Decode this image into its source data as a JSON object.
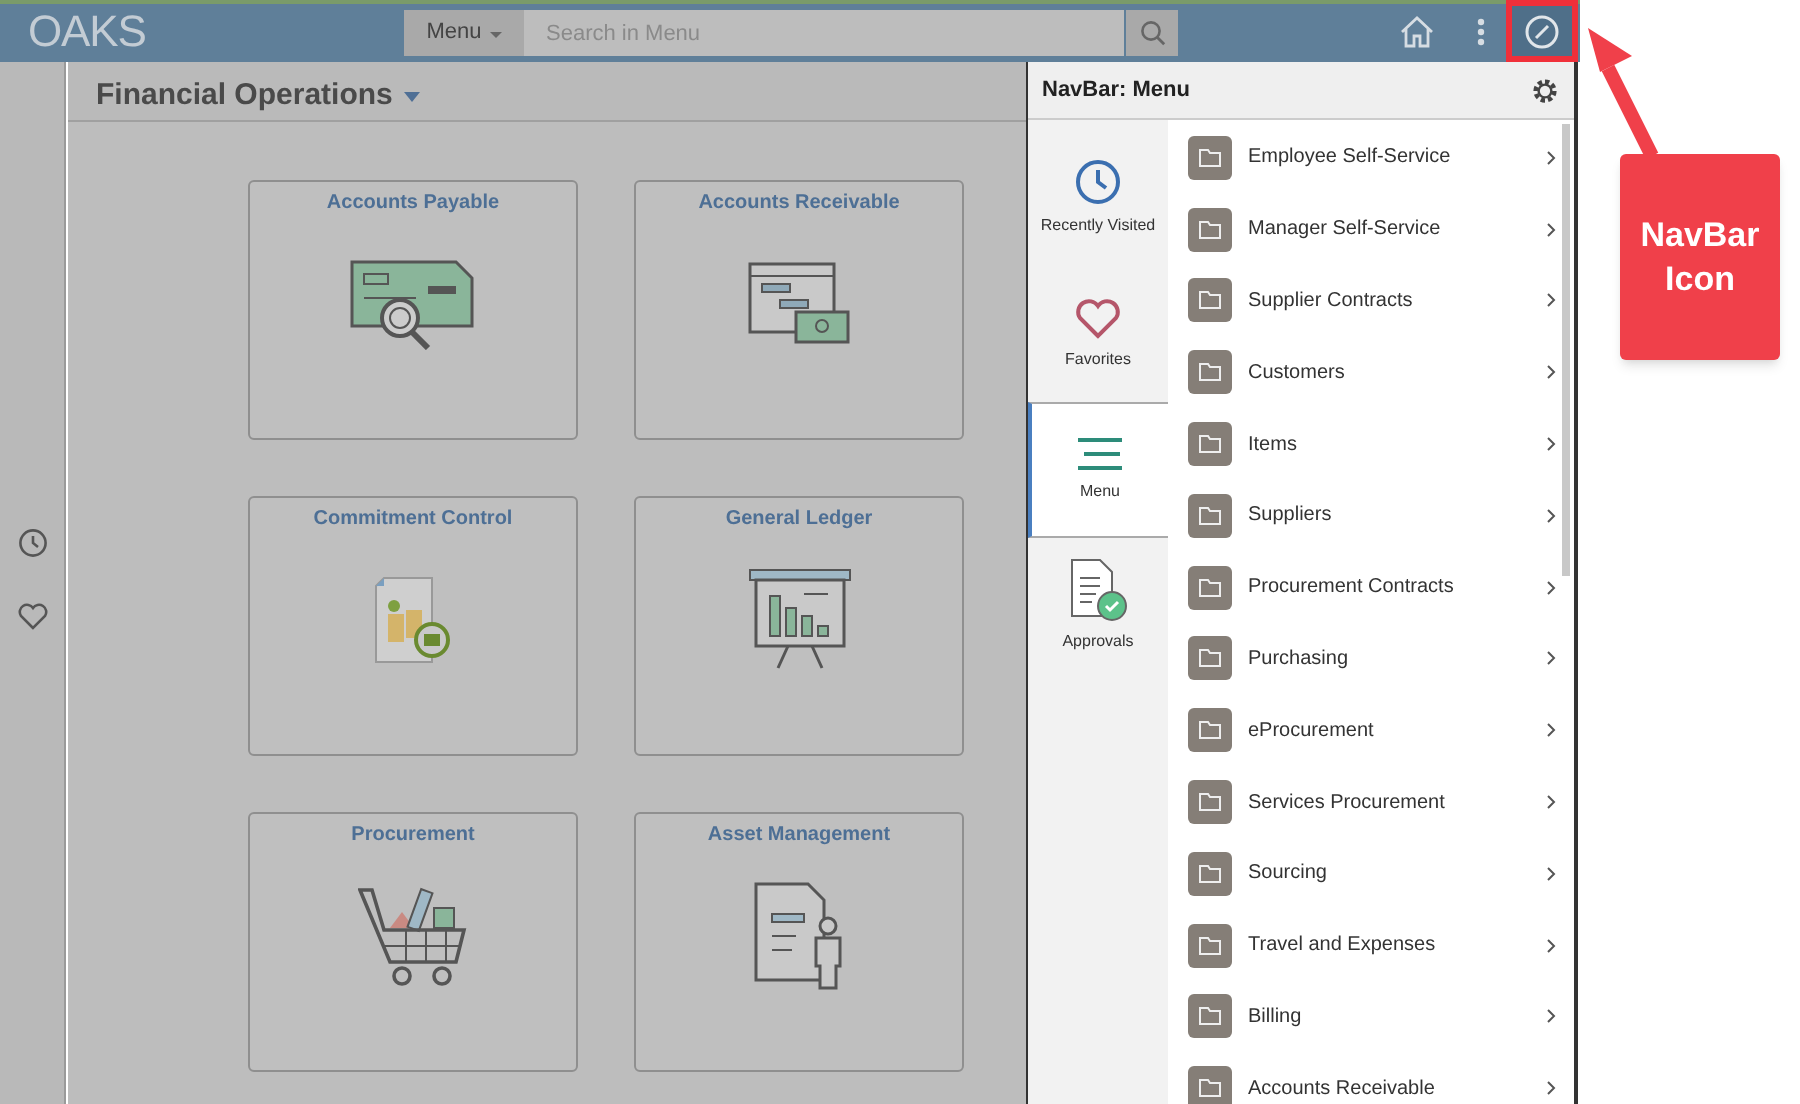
{
  "header": {
    "logo": "OAKS",
    "menu_button": "Menu",
    "search": {
      "placeholder": "Search in Menu"
    }
  },
  "page": {
    "title": "Financial Operations",
    "tiles": [
      {
        "label": "Accounts Payable",
        "kind": "check"
      },
      {
        "label": "Accounts Receivable",
        "kind": "invoice"
      },
      {
        "label": "Commitment Control",
        "kind": "approval"
      },
      {
        "label": "General Ledger",
        "kind": "chart"
      },
      {
        "label": "Procurement",
        "kind": "cart"
      },
      {
        "label": "Asset Management",
        "kind": "document"
      }
    ]
  },
  "navbar": {
    "title": "NavBar: Menu",
    "tabs": [
      {
        "label": "Recently Visited",
        "kind": "clock",
        "selected": false
      },
      {
        "label": "Favorites",
        "kind": "heart",
        "selected": false
      },
      {
        "label": "Menu",
        "kind": "menu",
        "selected": true
      },
      {
        "label": "Approvals",
        "kind": "approvals",
        "selected": false
      }
    ],
    "items": [
      {
        "label": "Employee Self-Service"
      },
      {
        "label": "Manager Self-Service"
      },
      {
        "label": "Supplier Contracts"
      },
      {
        "label": "Customers"
      },
      {
        "label": "Items"
      },
      {
        "label": "Suppliers"
      },
      {
        "label": "Procurement Contracts"
      },
      {
        "label": "Purchasing"
      },
      {
        "label": "eProcurement"
      },
      {
        "label": "Services Procurement"
      },
      {
        "label": "Sourcing"
      },
      {
        "label": "Travel and Expenses"
      },
      {
        "label": "Billing"
      },
      {
        "label": "Accounts Receivable"
      }
    ]
  },
  "callout": {
    "text": "NavBar Icon"
  }
}
